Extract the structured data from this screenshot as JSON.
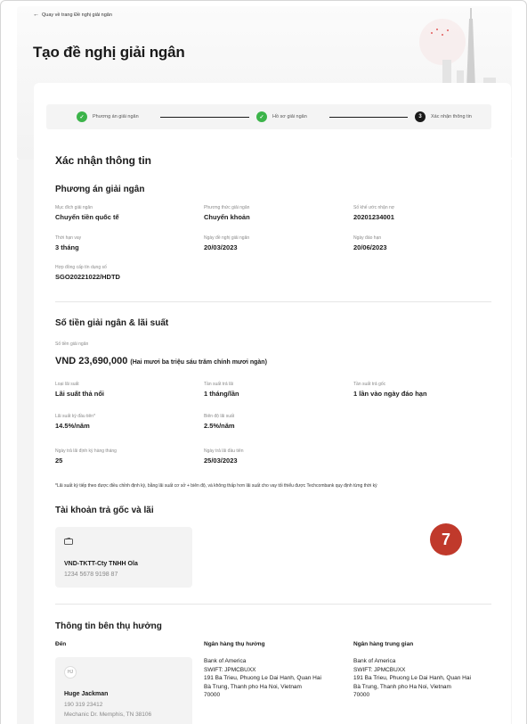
{
  "header": {
    "back_label": "Quay về trang Đề nghị giải ngân",
    "page_title": "Tạo đề nghị giải ngân"
  },
  "stepper": {
    "steps": [
      {
        "label": "Phương án giải ngân",
        "state": "done"
      },
      {
        "label": "Hồ sơ giải ngân",
        "state": "done"
      },
      {
        "label": "Xác nhận thông tin",
        "state": "current",
        "number": "3"
      }
    ]
  },
  "confirm": {
    "title": "Xác nhận thông tin"
  },
  "plan": {
    "title": "Phương án giải ngân",
    "fields": [
      {
        "label": "Mục đích giải ngân",
        "value": "Chuyển tiền quốc tế"
      },
      {
        "label": "Phương thức giải ngân",
        "value": "Chuyển khoản"
      },
      {
        "label": "Số khế ước nhận nợ",
        "value": "20201234001"
      },
      {
        "label": "Thời hạn vay",
        "value": "3 tháng"
      },
      {
        "label": "Ngày đề nghị giải ngân",
        "value": "20/03/2023"
      },
      {
        "label": "Ngày đáo hạn",
        "value": "20/06/2023"
      },
      {
        "label": "Hợp đồng cấp tín dụng số",
        "value": "SGO20221022/HDTD"
      }
    ]
  },
  "amount": {
    "title": "Số tiền giải ngân & lãi suất",
    "label": "Số tiền giải ngân",
    "value": "VND 23,690,000",
    "words": "(Hai mươi ba triệu sáu trăm chính mươi ngàn)",
    "fields": [
      {
        "label": "Loại lãi suất",
        "value": "Lãi suất thả nổi"
      },
      {
        "label": "Tần suất trả lãi",
        "value": "1 tháng/lần"
      },
      {
        "label": "Tần suất trả gốc",
        "value": "1 lần vào ngày đáo hạn"
      },
      {
        "label": "Lãi suất kỳ đầu tiên*",
        "value": "14.5%/năm"
      },
      {
        "label": "Biên độ lãi suất",
        "value": "2.5%/năm"
      },
      {
        "label": "Ngày trả lãi định kỳ hàng tháng",
        "value": "25"
      },
      {
        "label": "Ngày trả lãi đầu tiên",
        "value": "25/03/2023"
      }
    ],
    "footnote": "*Lãi suất kỳ tiếp theo được điều chỉnh định kỳ, bằng lãi suất cơ sở + biên độ, và không thấp hơn lãi suất cho vay tối thiểu được Techcombank quy định từng thời kỳ"
  },
  "repay_account": {
    "title": "Tài khoản trả gốc và lãi",
    "name": "VND-TKTT-Cty TNHH Ola",
    "number": "1234 5678 9198 87"
  },
  "badge": {
    "value": "7"
  },
  "beneficiary": {
    "title": "Thông tin bên thụ hưởng",
    "to_label": "Đến",
    "avatar": "HJ",
    "name": "Huge Jackman",
    "phone": "190 319 23412",
    "address": "Mechanic Dr. Memphis, TN 38106",
    "bank_head": "Ngân hàng thụ hưởng",
    "bank_lines": [
      "Bank of America",
      "SWIFT: JPMCBUXX",
      "191 Ba Trieu, Phuong Le Dai Hanh, Quan Hai",
      "Bà Trung, Thanh pho Ha Noi, Vietnam",
      "70000"
    ],
    "inter_head": "Ngân hàng trung gian",
    "inter_lines": [
      "Bank of America",
      "SWIFT: JPMCBUXX",
      "191 Ba Trieu, Phuong Le Dai Hanh, Quan Hai",
      "Bà Trung, Thanh pho Ha Noi, Vietnam",
      "70000"
    ]
  },
  "colors": {
    "done": "#3cb44a",
    "current": "#1a1a1a",
    "badge": "#c0392b"
  }
}
